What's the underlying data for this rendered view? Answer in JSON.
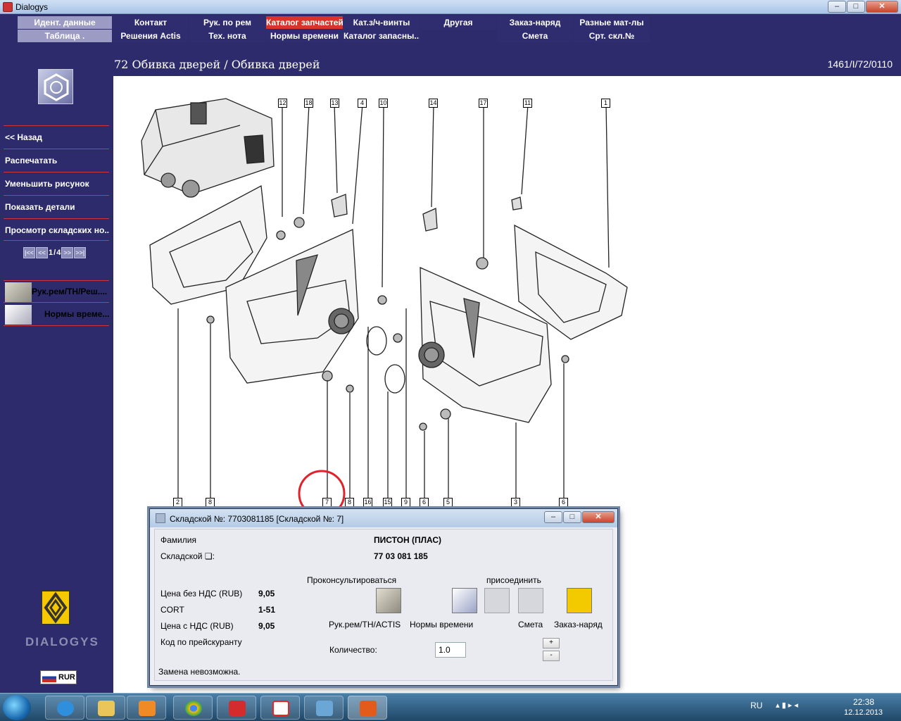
{
  "window": {
    "title": "Dialogys",
    "controls": {
      "minimize": "–",
      "maximize": "□",
      "close": "✕"
    }
  },
  "menu": {
    "row1": [
      "Идент. данные",
      "Контакт",
      "Рук. по рем",
      "Каталог запчастей",
      "Кат.з/ч-винты",
      "Другая",
      "Заказ-наряд",
      "Разные мат-лы"
    ],
    "row2": [
      "Таблица .",
      "Решения Actis",
      "Тех. нота",
      "Нормы времени",
      "Каталог запасны...",
      "",
      "Смета",
      "Срт. скл.№"
    ],
    "active": "Каталог запчастей",
    "accent_color": "#d9342b"
  },
  "header": {
    "title": "72 Обивка дверей / Обивка дверей",
    "ref_code": "1461/I/72/0110"
  },
  "sidebar": {
    "items": [
      "<< Назад",
      "Распечатать",
      "Уменьшить рисунок",
      "Показать детали",
      "Просмотр складских но..."
    ],
    "pager": {
      "first": "|<<",
      "prev": "<<",
      "current": "1",
      "sep": "/",
      "total": "4",
      "next": ">>",
      "last": ">>|"
    },
    "tools": [
      "Рук.рем/ТН/Реш....",
      "Нормы време..."
    ],
    "brand": "DIALOGYS",
    "currency": "RUR"
  },
  "diagram": {
    "callouts_top": [
      "12",
      "18",
      "13",
      "4",
      "10",
      "14",
      "17",
      "11",
      "1"
    ],
    "callouts_bottom": [
      "2",
      "8",
      "7",
      "8",
      "16",
      "15",
      "9",
      "6",
      "5",
      "3",
      "6"
    ],
    "highlighted": "7",
    "highlight_color": "#e0232a"
  },
  "dialog": {
    "title": "Складской №: 7703081185 [Складской №: 7]",
    "labels": {
      "family": "Фамилия",
      "part_no": "Складской ❏:",
      "consult": "Проконсультироваться",
      "attach": "присоединить",
      "price_excl": "Цена без НДС (RUB)",
      "cort": "CORT",
      "price_incl": "Цена с НДС (RUB)",
      "price_code": "Код по прейскуранту",
      "quantity": "Количество:",
      "status": "Замена невозможна."
    },
    "values": {
      "family": "ПИСТОН (ПЛАС)",
      "part_no": "77 03 081 185",
      "price_excl": "9,05",
      "cort": "1-51",
      "price_incl": "9,05",
      "quantity": "1.0"
    },
    "actions": [
      "Рук.рем/ТН/ACTIS",
      "Нормы времени",
      "Смета",
      "Заказ-наряд"
    ],
    "stepper": {
      "plus": "+",
      "minus": "-"
    }
  },
  "taskbar": {
    "lang": "RU",
    "time": "22:38",
    "date": "12.12.2013"
  }
}
